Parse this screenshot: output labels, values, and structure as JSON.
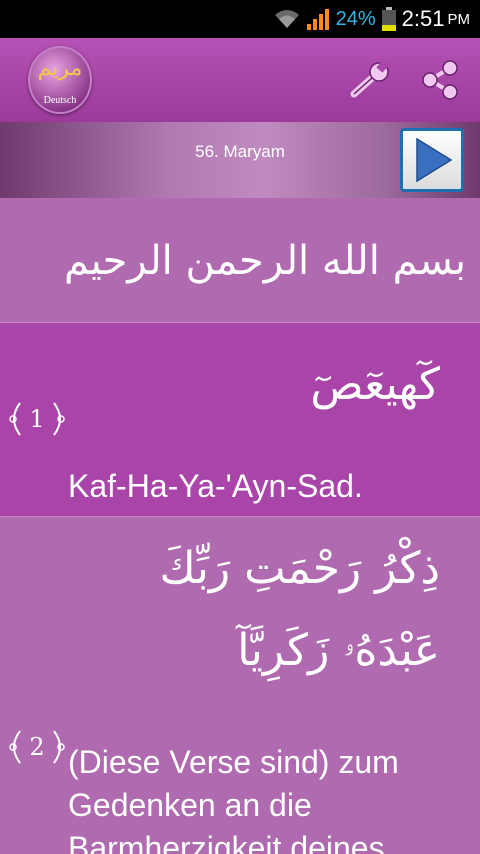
{
  "status_bar": {
    "battery_percent": "24%",
    "time": "2:51",
    "ampm": "PM",
    "icons": [
      "wifi-icon",
      "signal-icon",
      "battery-icon"
    ]
  },
  "app_bar": {
    "logo_arabic": "مريم",
    "logo_sub": "Deutsch",
    "actions": [
      "tools-icon",
      "share-icon"
    ],
    "colors": {
      "bar": "#a944a9",
      "accent_icon": "#f0c8f0"
    }
  },
  "title_bar": {
    "surah_title": "56. Maryam",
    "play_icon": "play-icon",
    "play_color": "#3a6fc0"
  },
  "bismillah": "بسم الله الرحمن الرحيم",
  "verses": [
    {
      "number": "1",
      "arabic": "كٓهيعٓصٓ",
      "translation": "Kaf-Ha-Ya-'Ayn-Sad."
    },
    {
      "number": "2",
      "arabic_line1": "ذِكْرُ رَحْمَتِ رَبِّكَ",
      "arabic_line2": "عَبْدَهُۥ زَكَرِيَّآ",
      "translation": "(Diese Verse sind) zum Gedenken an die Barmherzigkeit deines"
    }
  ]
}
